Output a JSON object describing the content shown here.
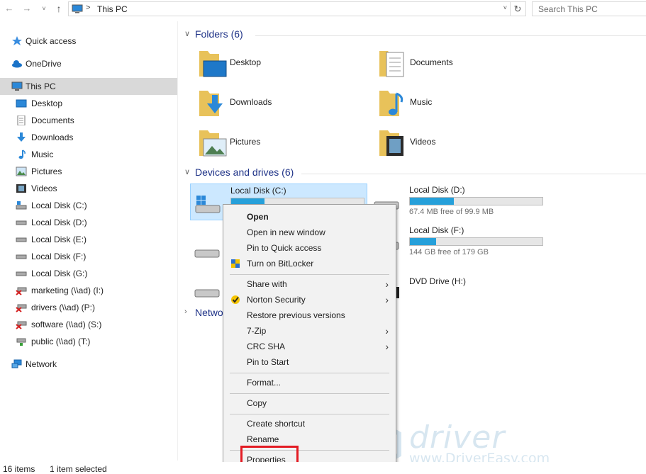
{
  "address_bar": {
    "back": "←",
    "forward": "→",
    "recent": "˅",
    "up": "↑",
    "breadcrumb_sep": ">",
    "location": "This PC",
    "dropdown": "˅",
    "refresh": "↻",
    "search_placeholder": "Search This PC"
  },
  "nav": {
    "items": [
      {
        "label": "Quick access",
        "icon": "star-icon"
      },
      {
        "label": "OneDrive",
        "icon": "cloud-icon"
      },
      {
        "label": "This PC",
        "icon": "computer-icon"
      },
      {
        "label": "Desktop",
        "icon": "desktop-icon"
      },
      {
        "label": "Documents",
        "icon": "documents-icon"
      },
      {
        "label": "Downloads",
        "icon": "download-icon"
      },
      {
        "label": "Music",
        "icon": "music-icon"
      },
      {
        "label": "Pictures",
        "icon": "pictures-icon"
      },
      {
        "label": "Videos",
        "icon": "videos-icon"
      },
      {
        "label": "Local Disk (C:)",
        "icon": "drive-icon"
      },
      {
        "label": "Local Disk (D:)",
        "icon": "drive-icon"
      },
      {
        "label": "Local Disk (E:)",
        "icon": "drive-icon"
      },
      {
        "label": "Local Disk (F:)",
        "icon": "drive-icon"
      },
      {
        "label": "Local Disk (G:)",
        "icon": "drive-icon"
      },
      {
        "label": "marketing (\\\\ad) (I:)",
        "icon": "network-drive-disconnected-icon"
      },
      {
        "label": "drivers (\\\\ad) (P:)",
        "icon": "network-drive-disconnected-icon"
      },
      {
        "label": "software (\\\\ad) (S:)",
        "icon": "network-drive-disconnected-icon"
      },
      {
        "label": "public (\\\\ad) (T:)",
        "icon": "network-drive-icon"
      },
      {
        "label": "Network",
        "icon": "network-icon"
      }
    ]
  },
  "content": {
    "folders_header": "Folders (6)",
    "devices_header": "Devices and drives (6)",
    "network_header": "Netwo",
    "folders": [
      {
        "name": "Desktop",
        "icon": "desktop-folder-icon"
      },
      {
        "name": "Documents",
        "icon": "documents-folder-icon"
      },
      {
        "name": "Downloads",
        "icon": "downloads-folder-icon"
      },
      {
        "name": "Music",
        "icon": "music-folder-icon"
      },
      {
        "name": "Pictures",
        "icon": "pictures-folder-icon"
      },
      {
        "name": "Videos",
        "icon": "videos-folder-icon"
      }
    ],
    "drives": [
      {
        "name": "Local Disk (C:)",
        "used_fraction": 0.25,
        "free_text": ""
      },
      {
        "name": "Local Disk (D:)",
        "used_fraction": 0.33,
        "free_text": "67.4 MB free of 99.9 MB"
      },
      {
        "name": "Local Disk (F:)",
        "used_fraction": 0.2,
        "free_text": "144 GB free of 179 GB"
      },
      {
        "name": "DVD Drive (H:)",
        "free_text": ""
      }
    ]
  },
  "context_menu": {
    "items": [
      {
        "label": "Open",
        "bold": true
      },
      {
        "label": "Open in new window"
      },
      {
        "label": "Pin to Quick access"
      },
      {
        "label": "Turn on BitLocker",
        "icon": "shield-icon"
      },
      {
        "label": "Share with",
        "submenu": true
      },
      {
        "label": "Norton Security",
        "icon": "norton-check-icon",
        "submenu": true
      },
      {
        "label": "Restore previous versions"
      },
      {
        "label": "7-Zip",
        "submenu": true
      },
      {
        "label": "CRC SHA",
        "submenu": true
      },
      {
        "label": "Pin to Start"
      },
      {
        "label": "Format..."
      },
      {
        "label": "Copy"
      },
      {
        "label": "Create shortcut"
      },
      {
        "label": "Rename"
      },
      {
        "label": "Properties"
      }
    ],
    "submenu_arrow": "›"
  },
  "status": {
    "items_count": "16 items",
    "selection": "1 item selected"
  },
  "watermark": {
    "brand": "driver easy",
    "site": "www.DriverEasy.com"
  },
  "colors": {
    "header_blue": "#1e3287",
    "selection_bg": "#cce8ff",
    "bar_fill": "#26a0da",
    "highlight_red": "#e31b23"
  }
}
